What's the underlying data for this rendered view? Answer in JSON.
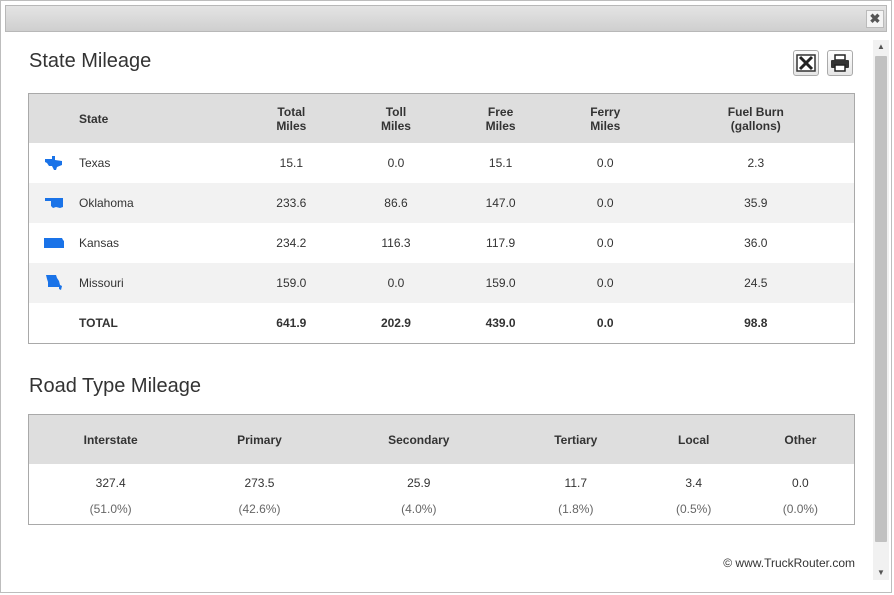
{
  "close_label": "✖",
  "state_section": {
    "title": "State Mileage",
    "columns": [
      "State",
      "Total\nMiles",
      "Toll\nMiles",
      "Free\nMiles",
      "Ferry\nMiles",
      "Fuel Burn\n(gallons)"
    ],
    "col": {
      "state": "State",
      "total_1": "Total",
      "total_2": "Miles",
      "toll_1": "Toll",
      "toll_2": "Miles",
      "free_1": "Free",
      "free_2": "Miles",
      "ferry_1": "Ferry",
      "ferry_2": "Miles",
      "fuel_1": "Fuel Burn",
      "fuel_2": "(gallons)"
    },
    "rows": [
      {
        "icon": "texas-shape-icon",
        "state": "Texas",
        "total": "15.1",
        "toll": "0.0",
        "free": "15.1",
        "ferry": "0.0",
        "fuel": "2.3"
      },
      {
        "icon": "oklahoma-shape-icon",
        "state": "Oklahoma",
        "total": "233.6",
        "toll": "86.6",
        "free": "147.0",
        "ferry": "0.0",
        "fuel": "35.9"
      },
      {
        "icon": "kansas-shape-icon",
        "state": "Kansas",
        "total": "234.2",
        "toll": "116.3",
        "free": "117.9",
        "ferry": "0.0",
        "fuel": "36.0"
      },
      {
        "icon": "missouri-shape-icon",
        "state": "Missouri",
        "total": "159.0",
        "toll": "0.0",
        "free": "159.0",
        "ferry": "0.0",
        "fuel": "24.5"
      }
    ],
    "total": {
      "label": "TOTAL",
      "total": "641.9",
      "toll": "202.9",
      "free": "439.0",
      "ferry": "0.0",
      "fuel": "98.8"
    }
  },
  "road_section": {
    "title": "Road Type Mileage",
    "columns": [
      "Interstate",
      "Primary",
      "Secondary",
      "Tertiary",
      "Local",
      "Other"
    ],
    "values": [
      "327.4",
      "273.5",
      "25.9",
      "11.7",
      "3.4",
      "0.0"
    ],
    "percents": [
      "(51.0%)",
      "(42.6%)",
      "(4.0%)",
      "(1.8%)",
      "(0.5%)",
      "(0.0%)"
    ]
  },
  "footer": "© www.TruckRouter.com",
  "colors": {
    "state_icon": "#1a73e8",
    "header_bg": "#dedede",
    "alt_row_bg": "#f2f2f2"
  }
}
